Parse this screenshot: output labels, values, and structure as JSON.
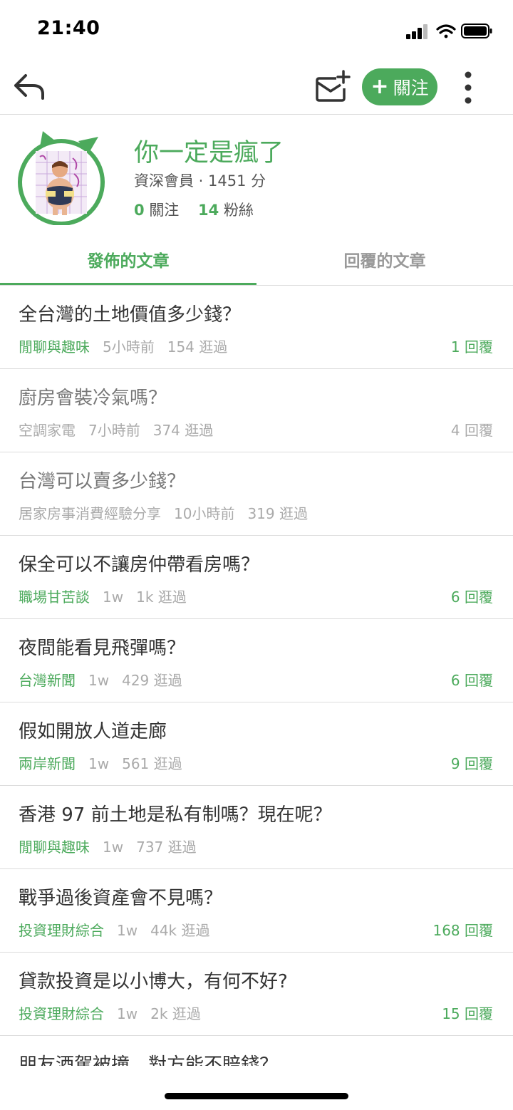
{
  "status_bar": {
    "time": "21:40",
    "icons": [
      "cellular-signal-icon",
      "wifi-icon",
      "battery-icon"
    ]
  },
  "nav": {
    "back_icon": "reply-back-icon",
    "mail_icon": "add-message-icon",
    "follow_label": "關注",
    "more_icon": "more-vertical-icon"
  },
  "profile": {
    "name": "你一定是瘋了",
    "rank": "資深會員",
    "score": "1451 分",
    "following_count": "0",
    "following_label": "關注",
    "followers_count": "14",
    "followers_label": "粉絲"
  },
  "tabs": [
    {
      "label": "發佈的文章",
      "active": true
    },
    {
      "label": "回覆的文章",
      "active": false
    }
  ],
  "posts": [
    {
      "title": "全台灣的土地價值多少錢？",
      "board": "閒聊與趣味",
      "time": "5小時前",
      "views": "154 逛過",
      "replies": "1 回覆",
      "read": false
    },
    {
      "title": "廚房會裝冷氣嗎？",
      "board": "空調家電",
      "time": "7小時前",
      "views": "374 逛過",
      "replies": "4 回覆",
      "read": true
    },
    {
      "title": "台灣可以賣多少錢？",
      "board": "居家房事消費經驗分享",
      "time": "10小時前",
      "views": "319 逛過",
      "replies": "",
      "read": true
    },
    {
      "title": "保全可以不讓房仲帶看房嗎？",
      "board": "職場甘苦談",
      "time": "1w",
      "views": "1k 逛過",
      "replies": "6 回覆",
      "read": false
    },
    {
      "title": "夜間能看見飛彈嗎？",
      "board": "台灣新聞",
      "time": "1w",
      "views": "429 逛過",
      "replies": "6 回覆",
      "read": false
    },
    {
      "title": "假如開放人道走廊",
      "board": "兩岸新聞",
      "time": "1w",
      "views": "561 逛過",
      "replies": "9 回覆",
      "read": false
    },
    {
      "title": "香港 97 前土地是私有制嗎？現在呢？",
      "board": "閒聊與趣味",
      "time": "1w",
      "views": "737 逛過",
      "replies": "",
      "read": false
    },
    {
      "title": "戰爭過後資產會不見嗎？",
      "board": "投資理財綜合",
      "time": "1w",
      "views": "44k 逛過",
      "replies": "168 回覆",
      "read": false
    },
    {
      "title": "貸款投資是以小博大，有何不好?",
      "board": "投資理財綜合",
      "time": "1w",
      "views": "2k 逛過",
      "replies": "15 回覆",
      "read": false
    },
    {
      "title": "朋友酒駕被撞，對方能不賠錢？",
      "board": "",
      "time": "",
      "views": "",
      "replies": "",
      "read": false
    }
  ],
  "colors": {
    "accent": "#4caa5c",
    "text": "#333333",
    "muted": "#aaaaaa",
    "divider": "#dcdcdc"
  }
}
